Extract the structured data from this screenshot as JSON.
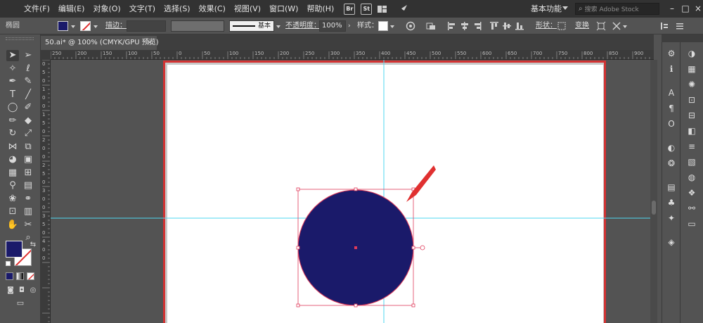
{
  "menubar": {
    "items": [
      "文件(F)",
      "编辑(E)",
      "对象(O)",
      "文字(T)",
      "选择(S)",
      "效果(C)",
      "视图(V)",
      "窗口(W)",
      "帮助(H)"
    ],
    "apps": [
      "Br",
      "St"
    ],
    "workspace": "基本功能",
    "stock_placeholder": "搜索 Adobe Stock",
    "window_controls": [
      "–",
      "□",
      "×"
    ]
  },
  "controlbar": {
    "selection_label": "椭圆",
    "stroke_label": "描边：",
    "stroke_profile": "基本",
    "opacity_label": "不透明度：",
    "opacity_value": "100%",
    "style_label": "样式：",
    "shape_label": "形状：",
    "transform_label": "变换",
    "fill_color": "#1a1a6a",
    "stroke_color": "#e03030"
  },
  "document": {
    "tab_title": "50.ai* @ 100% (CMYK/GPU 预览)",
    "close_glyph": "×"
  },
  "ruler": {
    "h_labels": [
      "250",
      "200",
      "150",
      "100",
      "50",
      "0",
      "50",
      "100",
      "150",
      "200",
      "250",
      "300",
      "350",
      "400",
      "450",
      "500",
      "550",
      "600",
      "650",
      "700",
      "750",
      "800",
      "850",
      "900",
      "950"
    ],
    "v_labels": [
      "0",
      "5",
      "0",
      "1",
      "0",
      "0",
      "1",
      "5",
      "0",
      "2",
      "0",
      "0",
      "2",
      "5",
      "0",
      "3",
      "0",
      "0",
      "3",
      "5",
      "0",
      "4",
      "0",
      "0"
    ]
  },
  "artboard": {
    "object_type": "ellipse",
    "object_fill": "#1a1a6a",
    "object_stroke": "#e03030",
    "guide_color": "#4fd7f0",
    "selection_color": "#e03a5a",
    "annotation_arrow_color": "#e03030"
  },
  "tools": {
    "left": [
      "selection-tool",
      "magic-wand-tool",
      "pen-tool",
      "type-tool",
      "ellipse-tool",
      "shaper-tool",
      "rotate-tool",
      "width-tool",
      "shape-builder-tool",
      "perspective-grid-tool",
      "eyedropper-tool",
      "symbol-sprayer-tool",
      "artboard-tool",
      "hand-tool"
    ],
    "right": [
      "direct-selection-tool",
      "lasso-tool",
      "curvature-tool",
      "line-segment-tool",
      "paintbrush-tool",
      "eraser-tool",
      "scale-tool",
      "free-transform-tool",
      "live-paint-tool",
      "mesh-tool",
      "gradient-tool",
      "blend-tool",
      "column-graph-tool",
      "slice-tool",
      "zoom-tool"
    ]
  },
  "panels": {
    "col1": [
      "properties-icon",
      "info-icon",
      "character-icon",
      "paragraph-icon",
      "opentype-icon",
      "transparency-icon",
      "color-guide-icon",
      "libraries-icon",
      "symbols-icon",
      "brushes-icon",
      "layers-icon"
    ],
    "col2": [
      "color-icon",
      "swatches-icon",
      "navigator-icon",
      "transform-icon",
      "align-icon",
      "pathfinder-icon",
      "stroke-icon",
      "gradient-icon",
      "appearance-icon",
      "graphic-styles-icon",
      "links-icon",
      "artboards-icon"
    ]
  }
}
